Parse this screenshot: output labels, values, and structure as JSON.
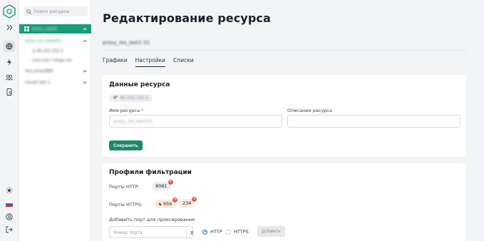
{
  "search": {
    "placeholder": "Поиск ресурса"
  },
  "tree": [
    {
      "label": "proxy_cbe44",
      "selected": true
    },
    {
      "label": "proxy_res_test101",
      "green": true
    },
    {
      "label": "ip 80.202.255.4"
    },
    {
      "label": "host-sub-7.ibrgp.net"
    },
    {
      "label": "test_proxy689"
    },
    {
      "label": "transit test 1"
    }
  ],
  "page": {
    "title": "Редактирование ресурса",
    "resource_name": "proxy_res_test1 01"
  },
  "tabs": [
    {
      "label": "Графики",
      "active": false
    },
    {
      "label": "Настройки",
      "active": true
    },
    {
      "label": "Списки",
      "active": false
    }
  ],
  "resource_card": {
    "title": "Данные ресурса",
    "ip_prefix": "IP",
    "ip_value": "80.202.255.4",
    "name_label": "Имя ресурса",
    "required_mark": "*",
    "name_value": "proxy_res_test101",
    "description_label": "Описание ресурса",
    "description_value": "",
    "save_label": "Сохранить"
  },
  "filter_card": {
    "title": "Профили фильтрации",
    "http_label": "Порты HTTP:",
    "http_ports": [
      "8081"
    ],
    "https_label": "Порты HTTPS:",
    "https_ports": [
      {
        "value": "656",
        "icon": "lightning-icon"
      },
      {
        "value": "234"
      }
    ],
    "add_label": "Добавить порт для проксирования",
    "port_placeholder": "Номер порта",
    "protocols": [
      {
        "label": "HTTP",
        "selected": true
      },
      {
        "label": "HTTPS",
        "selected": false
      }
    ],
    "add_button": "Добавить"
  },
  "colors": {
    "accent": "#1a9c77",
    "button": "#1a8a69",
    "delete": "#e25a4f",
    "radio": "#2b6cde"
  }
}
